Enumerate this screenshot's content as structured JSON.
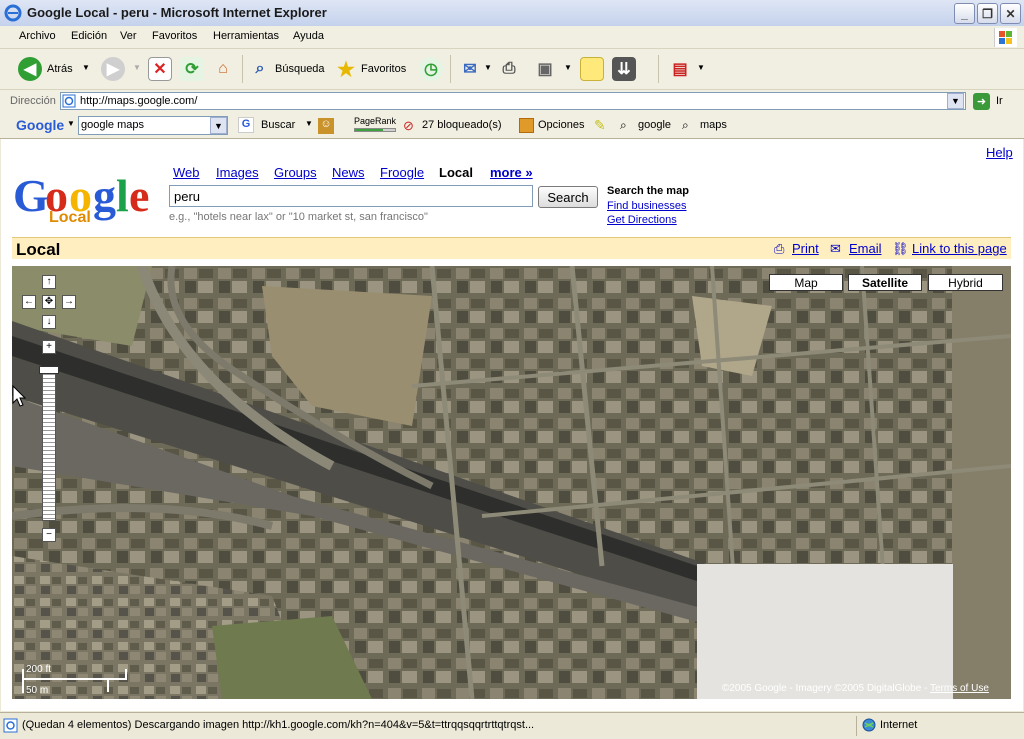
{
  "window": {
    "title": "Google Local - peru - Microsoft Internet Explorer"
  },
  "menu": [
    "Archivo",
    "Edición",
    "Ver",
    "Favoritos",
    "Herramientas",
    "Ayuda"
  ],
  "toolbar": {
    "back_label": "Atrás",
    "search_label": "Búsqueda",
    "favorites_label": "Favoritos"
  },
  "address": {
    "label": "Dirección",
    "url": "http://maps.google.com/",
    "go_label": "Ir"
  },
  "google_toolbar": {
    "logo": "Google",
    "query": "google maps",
    "search_label": "Buscar",
    "pagerank_label": "PageRank",
    "blocked_label": "27 bloqueado(s)",
    "options_label": "Opciones",
    "btn_google": "google",
    "btn_maps": "maps"
  },
  "page": {
    "help": "Help",
    "logo_local": "Local",
    "nav": {
      "web": "Web",
      "images": "Images",
      "groups": "Groups",
      "news": "News",
      "froogle": "Froogle",
      "local": "Local",
      "more": "more »"
    },
    "search": {
      "value": "peru",
      "button": "Search",
      "hint": "e.g., \"hotels near lax\" or \"10 market st, san francisco\""
    },
    "search_the_map": {
      "title": "Search the map",
      "find_businesses": "Find businesses",
      "get_directions": "Get Directions"
    },
    "header": {
      "title": "Local",
      "print": "Print",
      "email": "Email",
      "link": "Link to this page"
    }
  },
  "map": {
    "types": {
      "map": "Map",
      "satellite": "Satellite",
      "hybrid": "Hybrid"
    },
    "selected_type": "Satellite",
    "scale_ft": "200 ft",
    "scale_m": "50 m",
    "copyright": "©2005 Google - Imagery ©2005 DigitalGlobe - ",
    "terms": "Terms of Use"
  },
  "status": {
    "text": "(Quedan 4 elementos) Descargando imagen http://kh1.google.com/kh?n=404&v=5&t=ttrqqsqqrtrttqtrqst...",
    "zone": "Internet"
  },
  "colors": {
    "link": "#0000cc",
    "header_bg": "#ffefc0",
    "logo_local": "#e08a00"
  }
}
